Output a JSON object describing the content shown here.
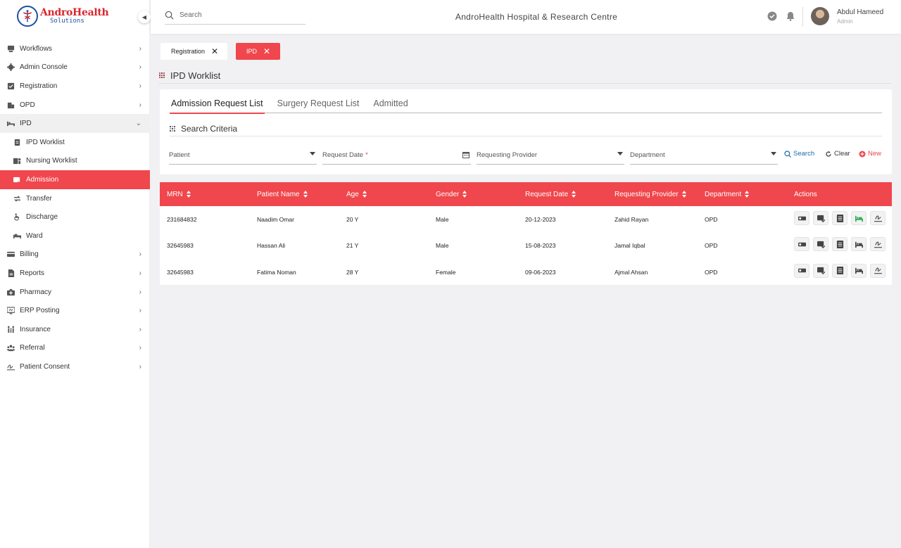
{
  "app": {
    "logo_title": "AndroHealth",
    "logo_subtitle": "Solutions",
    "hospital_name": "AndroHealth Hospital & Research Centre",
    "accent_color": "#f0464d"
  },
  "search": {
    "placeholder": "Search",
    "value": ""
  },
  "user": {
    "name": "Abdul Hameed",
    "role": "Admin"
  },
  "sidebar": {
    "items": [
      {
        "label": "Workflows",
        "icon": "workflow-icon"
      },
      {
        "label": "Admin Console",
        "icon": "gear-icon"
      },
      {
        "label": "Registration",
        "icon": "clipboard-check-icon"
      },
      {
        "label": "OPD",
        "icon": "building-icon"
      },
      {
        "label": "IPD",
        "icon": "bed-icon"
      },
      {
        "label": "IPD Worklist",
        "icon": "clipboard-icon"
      },
      {
        "label": "Nursing Worklist",
        "icon": "nurse-icon"
      },
      {
        "label": "Admission",
        "icon": "admission-icon"
      },
      {
        "label": "Transfer",
        "icon": "transfer-icon"
      },
      {
        "label": "Discharge",
        "icon": "wheelchair-icon"
      },
      {
        "label": "Ward",
        "icon": "ward-icon"
      },
      {
        "label": "Billing",
        "icon": "billing-icon"
      },
      {
        "label": "Reports",
        "icon": "report-icon"
      },
      {
        "label": "Pharmacy",
        "icon": "pharmacy-icon"
      },
      {
        "label": "ERP Posting",
        "icon": "monitor-icon"
      },
      {
        "label": "Insurance",
        "icon": "family-icon"
      },
      {
        "label": "Referral",
        "icon": "users-icon"
      },
      {
        "label": "Patient Consent",
        "icon": "signature-icon"
      }
    ]
  },
  "open_tabs": [
    {
      "label": "Registration"
    },
    {
      "label": "IPD"
    }
  ],
  "page_title": "IPD Worklist",
  "worklist_tabs": [
    {
      "label": "Admission Request List",
      "active": true
    },
    {
      "label": "Surgery Request List",
      "active": false
    },
    {
      "label": "Admitted",
      "active": false
    }
  ],
  "criteria": {
    "title": "Search Criteria",
    "patient": "Patient",
    "request_date": "Request Date",
    "required_mark": "*",
    "requesting_provider": "Requesting Provider",
    "department": "Department",
    "search_label": "Search",
    "clear_label": "Clear",
    "new_label": "New"
  },
  "table": {
    "headers": [
      "MRN",
      "Patient Name",
      "Age",
      "Gender",
      "Request Date",
      "Requesting Provider",
      "Department",
      "Actions"
    ],
    "rows": [
      {
        "mrn": "231684832",
        "name": "Naadim Omar",
        "age": "20 Y",
        "gender": "Male",
        "date": "20-12-2023",
        "provider": "Zahid Rayan",
        "dept": "OPD",
        "admit_enabled": true
      },
      {
        "mrn": "32645983",
        "name": "Hassan Ali",
        "age": "21 Y",
        "gender": "Male",
        "date": "15-08-2023",
        "provider": "Jamal Iqbal",
        "dept": "OPD",
        "admit_enabled": false
      },
      {
        "mrn": "32645983",
        "name": "Fatima Noman",
        "age": "28 Y",
        "gender": "Female",
        "date": "09-06-2023",
        "provider": "Ajmal Ahsan",
        "dept": "OPD",
        "admit_enabled": false
      }
    ]
  }
}
